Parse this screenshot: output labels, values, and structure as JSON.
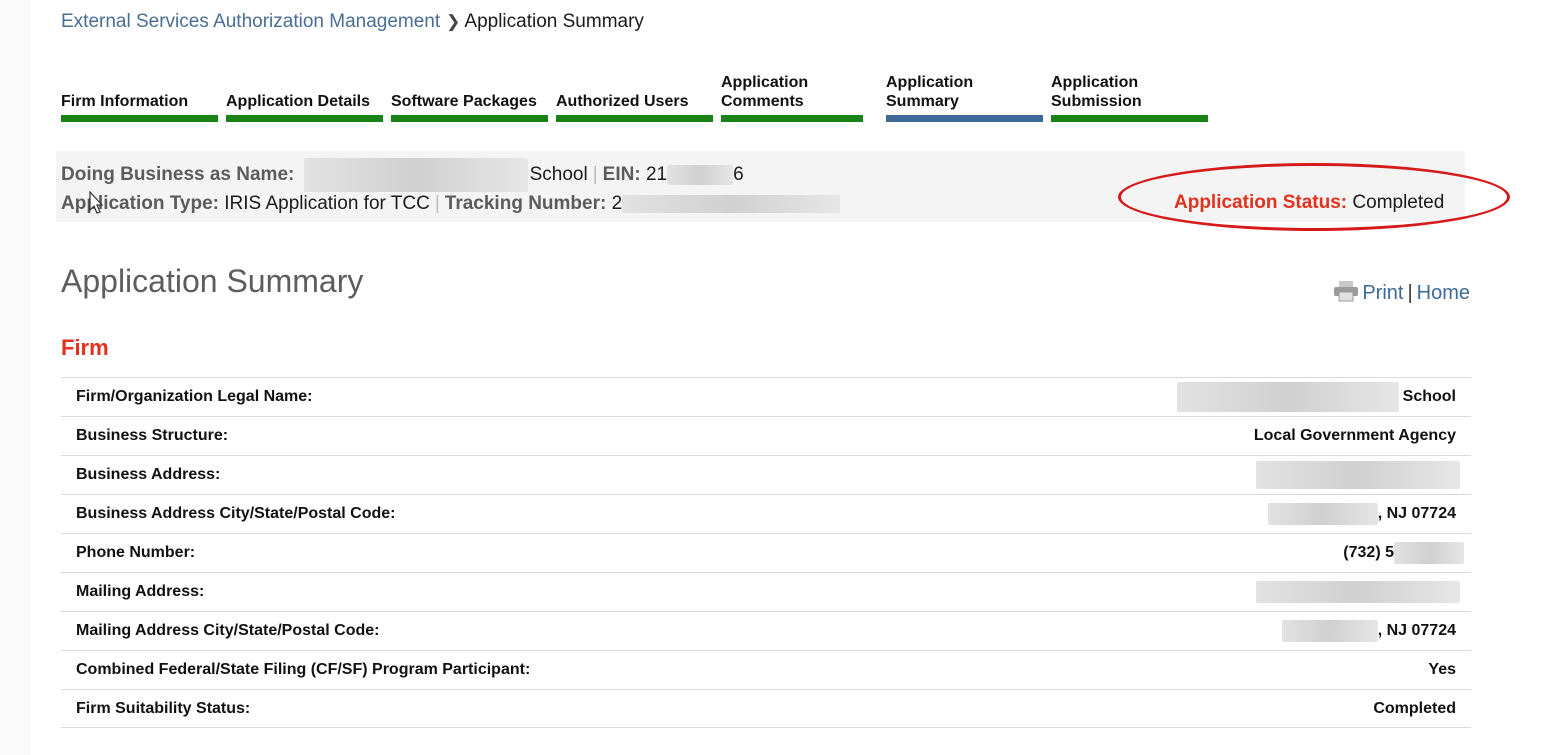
{
  "breadcrumb": {
    "parent": "External Services Authorization Management",
    "current": "Application Summary"
  },
  "steps": [
    {
      "label": "Firm Information",
      "active": false
    },
    {
      "label": "Application Details",
      "active": false
    },
    {
      "label": "Software Packages",
      "active": false
    },
    {
      "label": "Authorized Users",
      "active": false
    },
    {
      "label": "Application Comments",
      "active": false
    },
    {
      "label": "Application Summary",
      "active": true
    },
    {
      "label": "Application Submission",
      "active": false
    }
  ],
  "info": {
    "dba_label": "Doing Business as Name:",
    "dba_value": "School",
    "ein_label": "EIN:",
    "ein_prefix": "21",
    "ein_suffix": "6",
    "app_type_label": "Application Type:",
    "app_type_value": "IRIS Application for TCC",
    "tracking_label": "Tracking Number:",
    "tracking_prefix": "2",
    "status_label": "Application Status:",
    "status_value": "Completed"
  },
  "page": {
    "title": "Application Summary",
    "print_label": "Print",
    "home_label": "Home"
  },
  "firm": {
    "title": "Firm",
    "rows": [
      {
        "label": "Firm/Organization Legal Name:",
        "value": "School"
      },
      {
        "label": "Business Structure:",
        "value": "Local Government Agency"
      },
      {
        "label": "Business Address:",
        "value": ""
      },
      {
        "label": "Business Address City/State/Postal Code:",
        "value": ", NJ 07724"
      },
      {
        "label": "Phone Number:",
        "value": "(732) 5"
      },
      {
        "label": "Mailing Address:",
        "value": ""
      },
      {
        "label": "Mailing Address City/State/Postal Code:",
        "value": ", NJ 07724"
      },
      {
        "label": "Combined Federal/State Filing (CF/SF) Program Participant:",
        "value": "Yes"
      },
      {
        "label": "Firm Suitability Status:",
        "value": "Completed"
      }
    ]
  },
  "colors": {
    "accent_red": "#e2311d",
    "step_green": "#1a8318",
    "step_active_blue": "#3e6a98",
    "link_blue": "#3e6a98",
    "highlight_oval": "#d61a1a"
  }
}
